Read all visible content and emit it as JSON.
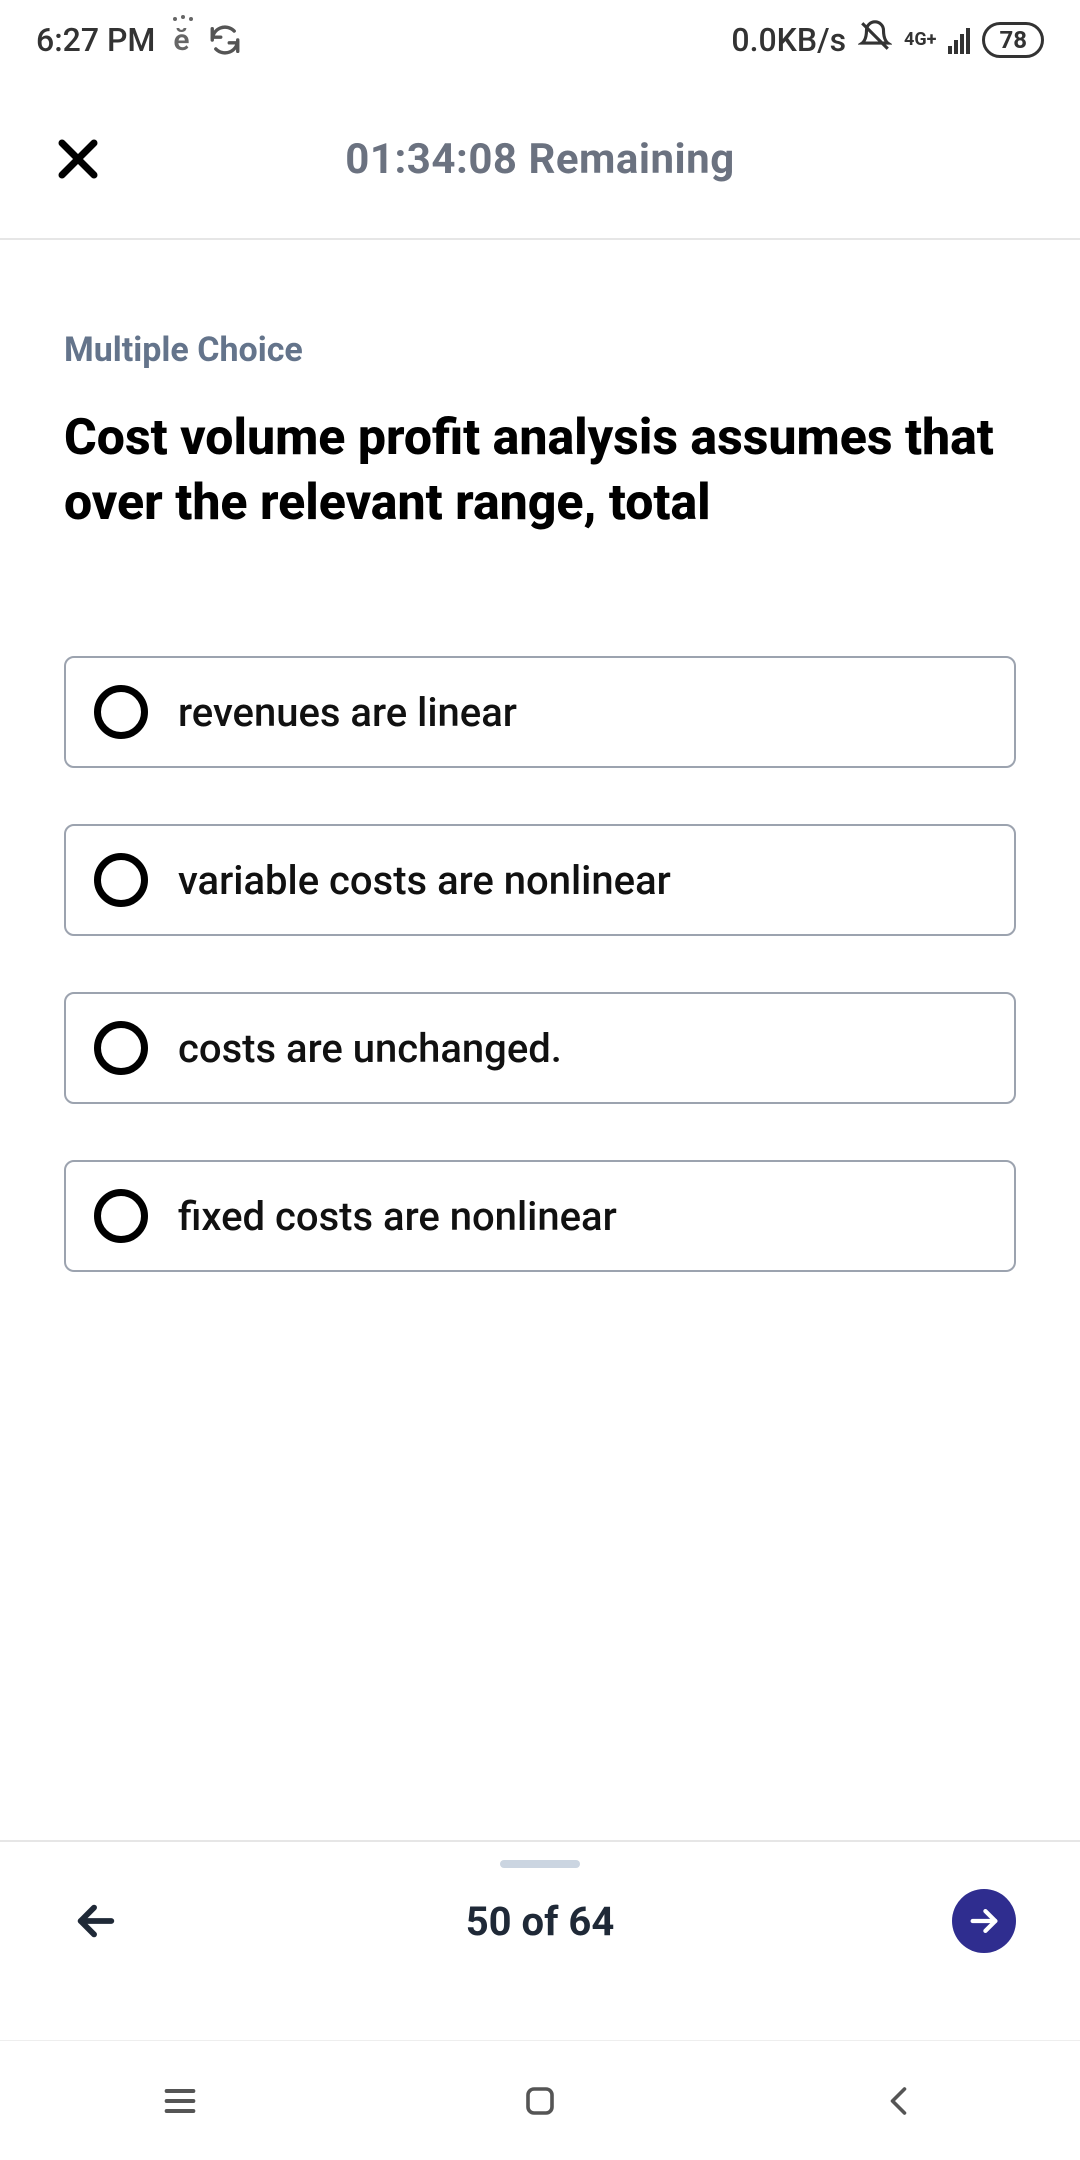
{
  "status": {
    "time": "6:27 PM",
    "data_rate": "0.0KB/s",
    "network_label": "4G+",
    "battery": "78"
  },
  "header": {
    "timer_text": "01:34:08 Remaining"
  },
  "question": {
    "type_label": "Multiple Choice",
    "text": "Cost volume profit analysis assumes that over the relevant range, total",
    "options": [
      "revenues are linear",
      "variable costs are nonlinear",
      "costs are unchanged.",
      "fixed costs are nonlinear"
    ]
  },
  "footer": {
    "progress": "50 of 64"
  },
  "colors": {
    "accent": "#2f2d8f",
    "muted": "#6b7280"
  }
}
